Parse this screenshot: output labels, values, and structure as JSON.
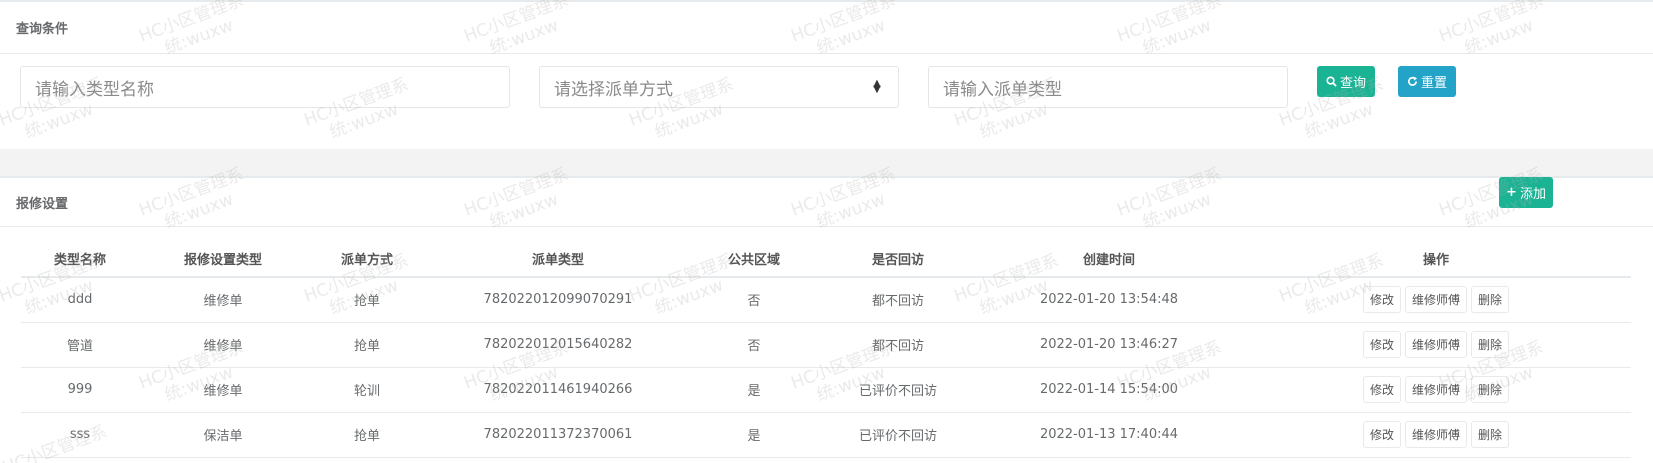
{
  "query": {
    "title": "查询条件",
    "type_name_placeholder": "请输入类型名称",
    "dispatch_method_placeholder": "请选择派单方式",
    "dispatch_type_placeholder": "请输入派单类型",
    "search_label": "查询",
    "reset_label": "重置"
  },
  "list": {
    "title": "报修设置",
    "add_label": "添加",
    "columns": [
      "类型名称",
      "报修设置类型",
      "派单方式",
      "派单类型",
      "公共区域",
      "是否回访",
      "创建时间",
      "操作"
    ],
    "rows": [
      {
        "name": "ddd",
        "setting_type": "维修单",
        "method": "抢单",
        "dispatch_type": "782022012099070291",
        "public_area": "否",
        "revisit": "都不回访",
        "created": "2022-01-20 13:54:48"
      },
      {
        "name": "管道",
        "setting_type": "维修单",
        "method": "抢单",
        "dispatch_type": "782022012015640282",
        "public_area": "否",
        "revisit": "都不回访",
        "created": "2022-01-20 13:46:27"
      },
      {
        "name": "999",
        "setting_type": "维修单",
        "method": "轮训",
        "dispatch_type": "782022011461940266",
        "public_area": "是",
        "revisit": "已评价不回访",
        "created": "2022-01-14 15:54:00"
      },
      {
        "name": "sss",
        "setting_type": "保洁单",
        "method": "抢单",
        "dispatch_type": "782022011372370061",
        "public_area": "是",
        "revisit": "已评价不回访",
        "created": "2022-01-13 17:40:44"
      }
    ],
    "row_actions": {
      "edit": "修改",
      "technician": "维修师傅",
      "delete": "删除"
    }
  },
  "watermark": {
    "line1": "HC小区管理系",
    "line2": "统:wuxw"
  },
  "colors": {
    "primary": "#1ab394",
    "info": "#23a3c7"
  }
}
